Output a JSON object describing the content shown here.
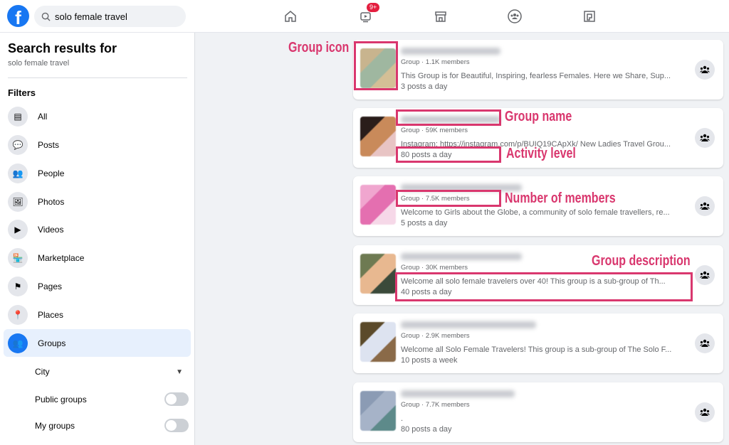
{
  "topbar": {
    "search_value": "solo female travel",
    "watch_badge": "9+",
    "nav": [
      "home-icon",
      "watch-icon",
      "marketplace-icon",
      "groups-icon",
      "gaming-icon"
    ]
  },
  "sidebar": {
    "title": "Search results for",
    "query": "solo female travel",
    "filters_label": "Filters",
    "items": [
      {
        "label": "All",
        "icon": "all-icon"
      },
      {
        "label": "Posts",
        "icon": "posts-icon"
      },
      {
        "label": "People",
        "icon": "people-icon"
      },
      {
        "label": "Photos",
        "icon": "photos-icon"
      },
      {
        "label": "Videos",
        "icon": "videos-icon"
      },
      {
        "label": "Marketplace",
        "icon": "marketplace-icon"
      },
      {
        "label": "Pages",
        "icon": "pages-icon"
      },
      {
        "label": "Places",
        "icon": "places-icon"
      },
      {
        "label": "Groups",
        "icon": "groups-icon",
        "selected": true
      }
    ],
    "sub": {
      "city": "City",
      "public": "Public groups",
      "mine": "My groups",
      "public_on": false,
      "mine_on": false
    }
  },
  "results": [
    {
      "meta": "Group · 1.1K members",
      "desc": "This Group is for Beautiful, Inspiring, fearless Females. Here we Share, Sup...",
      "activity": "3 posts a day",
      "colors": [
        "#c8b48e",
        "#9fb7a0",
        "#d4bf96"
      ]
    },
    {
      "meta": "Group · 59K members",
      "desc": "Instagram: https://instagram.com/p/BUIQ19CApXk/ New Ladies Travel Grou...",
      "activity": "80 posts a day",
      "colors": [
        "#2a1d1a",
        "#c98a5a",
        "#e8c4c4"
      ]
    },
    {
      "meta": "Group · 7.5K members",
      "desc": "Welcome to Girls about the Globe, a community of solo female travellers, re...",
      "activity": "5 posts a day",
      "colors": [
        "#f0a6cf",
        "#e46fb0",
        "#f6d8e8"
      ]
    },
    {
      "meta": "Group · 30K members",
      "desc": "Welcome all solo female travelers over 40! This group is a sub-group of Th...",
      "activity": "40 posts a day",
      "colors": [
        "#6e7a52",
        "#e8b890",
        "#3b4a3a"
      ]
    },
    {
      "meta": "Group · 2.9K members",
      "desc": "Welcome all Solo Female Travelers! This group is a sub-group of The Solo F...",
      "activity": "10 posts a week",
      "colors": [
        "#5b4a2a",
        "#dde3f0",
        "#8a6a48"
      ]
    },
    {
      "meta": "Group · 7.7K members",
      "desc": ".",
      "activity": "80 posts a day",
      "colors": [
        "#8b9bb4",
        "#a6b3c8",
        "#5d8a8a"
      ]
    }
  ],
  "annotations": {
    "icon": "Group icon",
    "name": "Group name",
    "activity": "Activity level",
    "members": "Number of members",
    "description": "Group description",
    "color": "#d9376e"
  }
}
